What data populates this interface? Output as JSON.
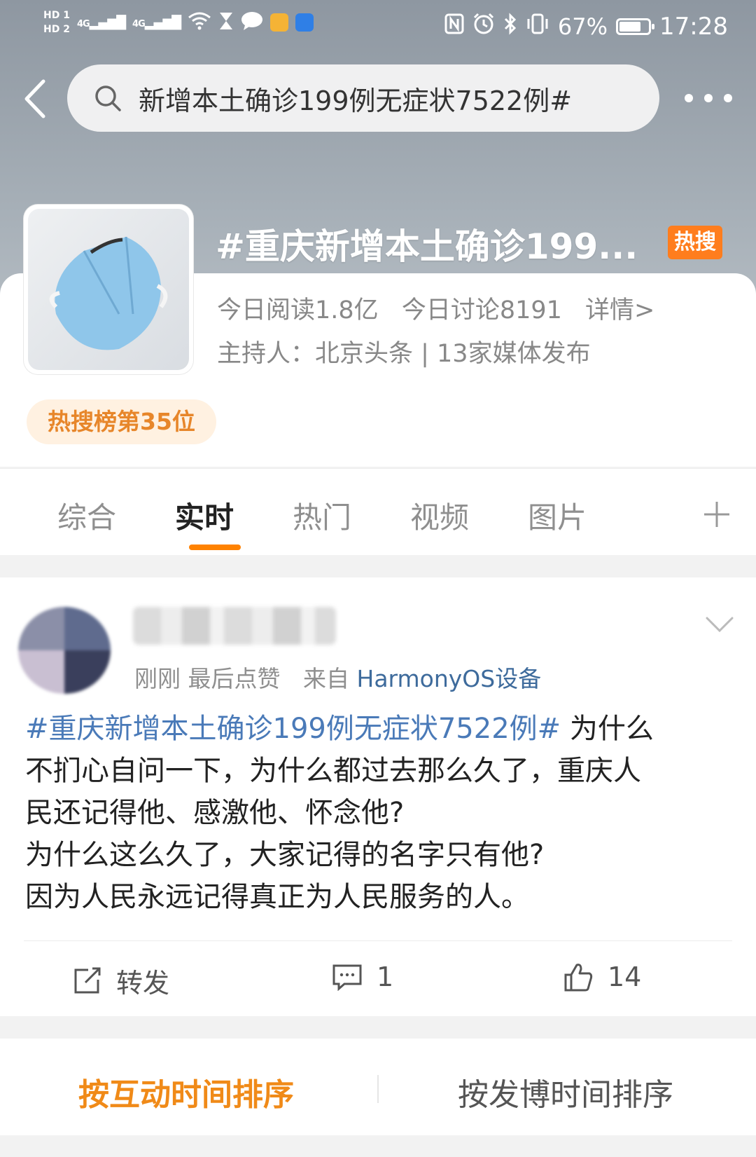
{
  "status_bar": {
    "sim1": "HD 1",
    "sim2": "HD 2",
    "signal1": "4G",
    "signal2": "4G",
    "battery": "67%",
    "time": "17:28"
  },
  "search": {
    "query": "新增本土确诊199例无症状7522例#"
  },
  "topic": {
    "title": "#重庆新增本土确诊199...",
    "hot_badge": "热搜",
    "reads": "今日阅读1.8亿",
    "discussions": "今日讨论8191",
    "details": "详情>",
    "host": "主持人：北京头条 | 13家媒体发布",
    "rank": "热搜榜第35位"
  },
  "tabs": [
    {
      "label": "综合"
    },
    {
      "label": "实时"
    },
    {
      "label": "热门"
    },
    {
      "label": "视频"
    },
    {
      "label": "图片"
    }
  ],
  "post": {
    "meta_time": "刚刚",
    "meta_like": "最后点赞",
    "meta_from": "来自",
    "meta_device": "HarmonyOS设备",
    "hashtag": "#重庆新增本土确诊199例无症状7522例#",
    "line1_tail": " 为什么",
    "line2": "不扪心自问一下，为什么都过去那么久了，重庆人",
    "line3": "民还记得他、感激他、怀念他?",
    "line4": "为什么这么久了，大家记得的名字只有他?",
    "line5": "因为人民永远记得真正为人民服务的人。",
    "repost_label": "转发",
    "comment_count": "1",
    "like_count": "14"
  },
  "sort": {
    "by_interaction": "按互动时间排序",
    "by_post_time": "按发博时间排序"
  },
  "colors": {
    "accent": "#ff8200",
    "hashtag": "#4a7ab8",
    "hot_badge": "#ff7d1d"
  }
}
